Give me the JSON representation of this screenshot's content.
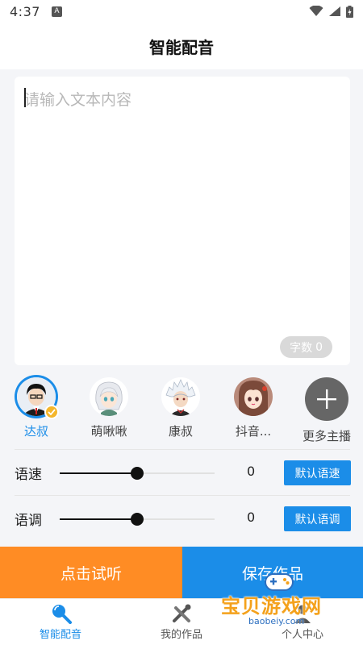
{
  "status_bar": {
    "time": "4:37",
    "notification_badge": "A"
  },
  "header": {
    "title": "智能配音"
  },
  "editor": {
    "placeholder": "请输入文本内容",
    "char_count_label": "字数",
    "char_count_value": "0"
  },
  "voices": [
    {
      "name": "达叔",
      "selected": true,
      "icon": "avatar-dashu"
    },
    {
      "name": "萌啾啾",
      "selected": false,
      "icon": "avatar-mengjiujiu"
    },
    {
      "name": "康叔",
      "selected": false,
      "icon": "avatar-kangshu"
    },
    {
      "name": "抖音...",
      "selected": false,
      "icon": "avatar-douyin"
    }
  ],
  "more_voices": {
    "label": "更多主播",
    "icon": "plus-icon"
  },
  "speed": {
    "label": "语速",
    "value": "0",
    "level": 0.5,
    "default_label": "默认语速"
  },
  "pitch": {
    "label": "语调",
    "value": "0",
    "level": 0.5,
    "default_label": "默认语调"
  },
  "actions": {
    "listen_label": "点击试听",
    "save_label": "保存作品"
  },
  "tabs": [
    {
      "label": "智能配音",
      "icon": "mic-icon",
      "active": true
    },
    {
      "label": "我的作品",
      "icon": "tools-icon",
      "active": false
    },
    {
      "label": "个人中心",
      "icon": "person-icon",
      "active": false
    }
  ],
  "watermark": {
    "text": "宝贝游戏网",
    "subtext": "baobeiy.com"
  },
  "colors": {
    "accent": "#1b8de8",
    "listen": "#ff8c24",
    "badge": "#f4b62c"
  }
}
